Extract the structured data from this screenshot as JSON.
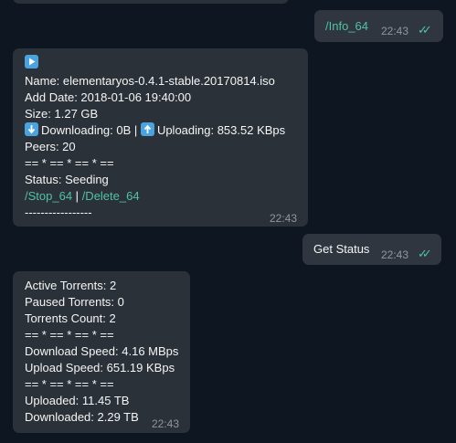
{
  "messages": {
    "info_cmd": {
      "text": "/Info_64",
      "time": "22:43"
    },
    "torrent_info": {
      "name": "Name: elementaryos-0.4.1-stable.20170814.iso",
      "add_date": "Add Date: 2018-01-06 19:40:00",
      "size": "Size: 1.27 GB",
      "downloading": "Downloading: 0B",
      "separator_bar": "|",
      "uploading": "Uploading: 853.52 KBps",
      "peers": "Peers: 20",
      "divider": "== * == * == * ==",
      "status": "Status: Seeding",
      "stop_link": "/Stop_64",
      "link_sep": "|",
      "delete_link": "/Delete_64",
      "dashes": "-----------------",
      "time": "22:43"
    },
    "get_status_cmd": {
      "text": "Get Status",
      "time": "22:43"
    },
    "status_info": {
      "active": "Active Torrents: 2",
      "paused": "Paused Torrents: 0",
      "count": "Torrents Count: 2",
      "divider1": "== * == * == * ==",
      "download_speed": "Download Speed: 4.16 MBps",
      "upload_speed": "Upload Speed: 651.19 KBps",
      "divider2": "== * == * == * ==",
      "uploaded": "Uploaded: 11.45 TB",
      "downloaded": "Downloaded: 2.29 TB",
      "time": "22:43"
    }
  },
  "icons": {
    "play": "play-button-icon",
    "down": "down-arrow-icon",
    "up": "up-arrow-icon",
    "read": "double-check-icon"
  },
  "colors": {
    "background": "#0e1621",
    "bubble": "#2b3138",
    "link": "#4fc3a1",
    "emoji_blue": "#4aa3df"
  }
}
